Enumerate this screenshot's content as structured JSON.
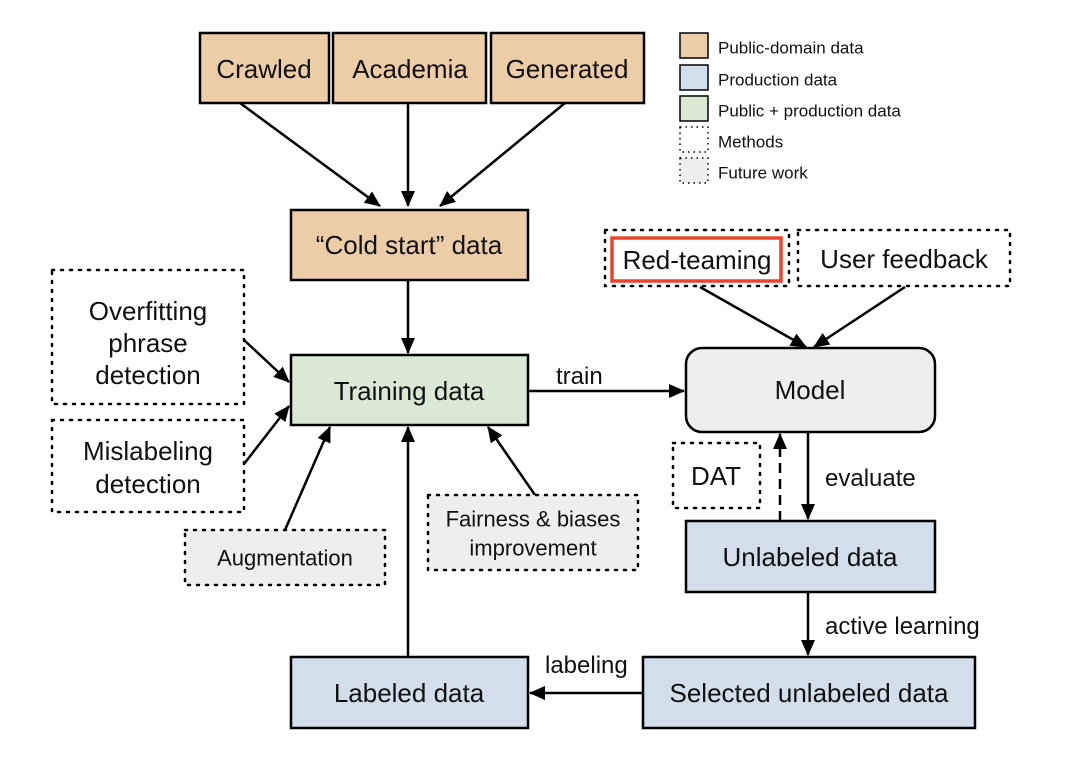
{
  "colors": {
    "public": "#EDCDA8",
    "production": "#D3DEEC",
    "both": "#DAE8D4",
    "future": "#EEEEEE",
    "model": "#EEEEEE",
    "highlight": "#E8452C"
  },
  "legend": [
    {
      "label": "Public-domain data",
      "style": "public"
    },
    {
      "label": "Production data",
      "style": "production"
    },
    {
      "label": "Public + production data",
      "style": "both"
    },
    {
      "label": "Methods",
      "style": "method"
    },
    {
      "label": "Future work",
      "style": "future"
    }
  ],
  "nodes": {
    "crawled": "Crawled",
    "academia": "Academia",
    "generated": "Generated",
    "cold_start": "“Cold start” data",
    "training": "Training data",
    "model": "Model",
    "red_teaming": "Red-teaming",
    "user_feedback": "User feedback",
    "overfitting": [
      "Overfitting",
      "phrase",
      "detection"
    ],
    "mislabeling": [
      "Mislabeling",
      "detection"
    ],
    "augmentation": "Augmentation",
    "fairness": [
      "Fairness & biases",
      "improvement"
    ],
    "dat": "DAT",
    "unlabeled": "Unlabeled data",
    "selected": "Selected unlabeled data",
    "labeled": "Labeled data"
  },
  "edges": {
    "train": "train",
    "evaluate": "evaluate",
    "active_learning": "active learning",
    "labeling": "labeling"
  }
}
